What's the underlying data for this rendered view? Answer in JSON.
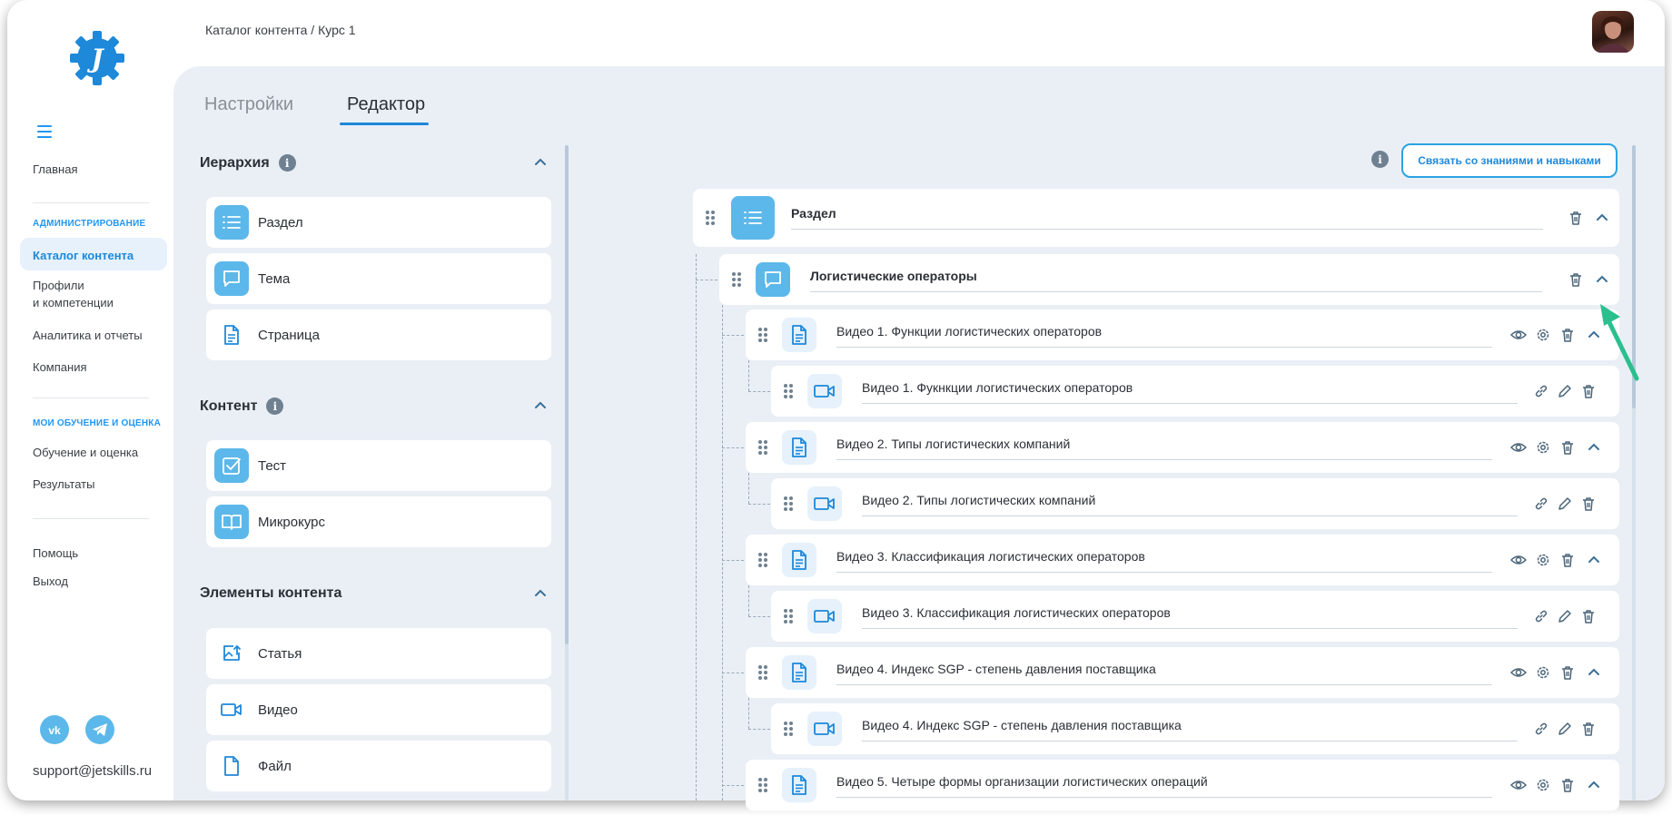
{
  "breadcrumb": "Каталог контента / Курс 1",
  "sidebar": {
    "home": "Главная",
    "admin_header": "АДМИНИСТРИРОВАНИЕ",
    "catalog": "Каталог контента",
    "profiles_line1": "Профили",
    "profiles_line2": "и компетенции",
    "analytics": "Аналитика и отчеты",
    "company": "Компания",
    "learning_header": "МОИ ОБУЧЕНИЕ И ОЦЕНКА",
    "learning": "Обучение и оценка",
    "results": "Результаты",
    "help": "Помощь",
    "logout": "Выход",
    "support_email": "support@jetskills.ru"
  },
  "tabs": {
    "settings": "Настройки",
    "editor": "Редактор"
  },
  "palette": {
    "hierarchy": {
      "title": "Иерархия",
      "items": [
        "Раздел",
        "Тема",
        "Страница"
      ]
    },
    "content": {
      "title": "Контент",
      "items": [
        "Тест",
        "Микрокурс"
      ]
    },
    "elements": {
      "title": "Элементы контента",
      "items": [
        "Статья",
        "Видео",
        "Файл"
      ]
    }
  },
  "editor": {
    "link_button": "Связать со знаниями и навыками",
    "section": "Раздел",
    "topic": "Логистические операторы",
    "pages": [
      "Видео 1. Функции логистических операторов",
      "Видео 2. Типы логистических компаний",
      "Видео 3. Классификация логистических операторов",
      "Видео 4. Индекс SGP - степень давления поставщика",
      "Видео 5. Четыре формы организации логистических операций"
    ],
    "videos": [
      "Видео 1. Фукнкции логистических операторов",
      "Видео 2. Типы логистических компаний",
      "Видео 3. Классификация логистических операторов",
      "Видео 4. Индекс SGP - степень давления поставщика"
    ]
  },
  "colors": {
    "accent": "#1e88d9",
    "icon_fill": "#5cb8ea",
    "panel_bg": "#eaeff6",
    "arrow": "#2bbf8e"
  },
  "icons": [
    "logo-gear-icon",
    "menu-icon",
    "info-icon",
    "chevron-up-icon",
    "list-icon",
    "chat-icon",
    "document-icon",
    "checkbox-icon",
    "book-icon",
    "image-upload-icon",
    "video-icon",
    "file-icon",
    "grip-icon",
    "trash-icon",
    "eye-icon",
    "gear-icon",
    "link-icon",
    "pencil-icon",
    "vk-icon",
    "telegram-icon"
  ]
}
